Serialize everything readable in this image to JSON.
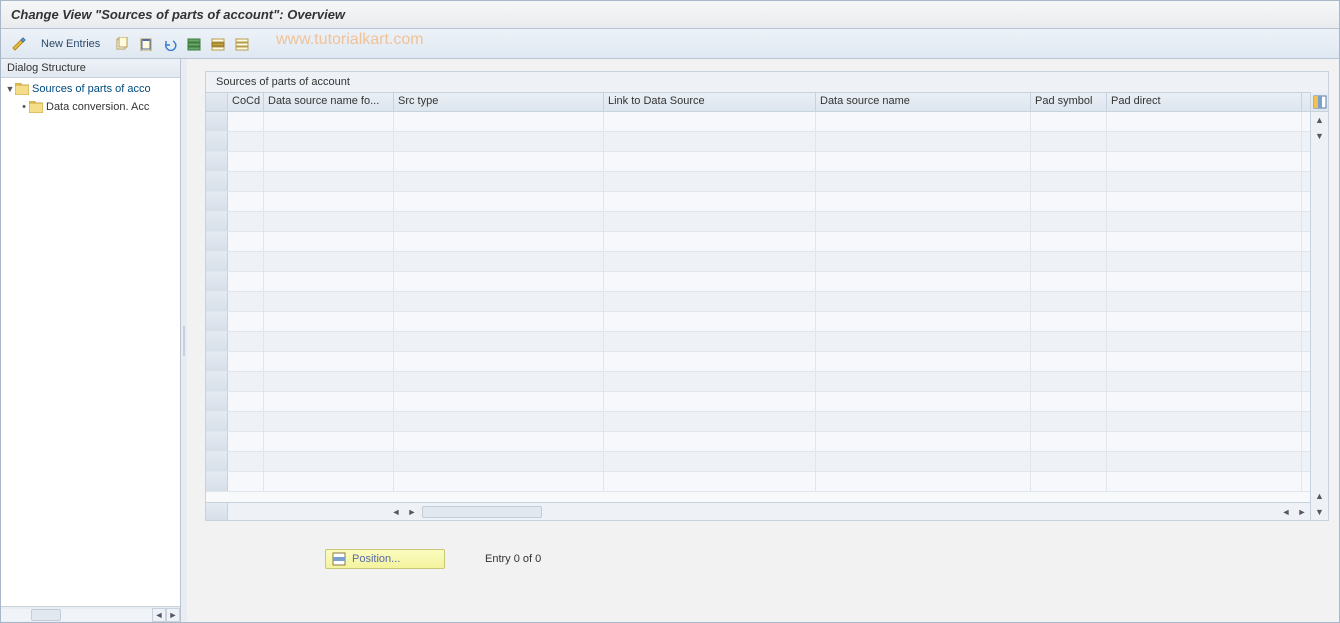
{
  "title": "Change View \"Sources of parts of account\": Overview",
  "watermark": "www.tutorialkart.com",
  "toolbar": {
    "new_entries": "New Entries"
  },
  "dialog_structure": {
    "header": "Dialog Structure",
    "root": "Sources of parts of acco",
    "child": "Data conversion. Acc"
  },
  "panel": {
    "title": "Sources of parts of account",
    "columns": [
      "CoCd",
      "Data source name fo...",
      "Src type",
      "Link to Data Source",
      "Data source name",
      "Pad symbol",
      "Pad direct"
    ]
  },
  "footer": {
    "position": "Position...",
    "entry": "Entry 0 of 0"
  }
}
